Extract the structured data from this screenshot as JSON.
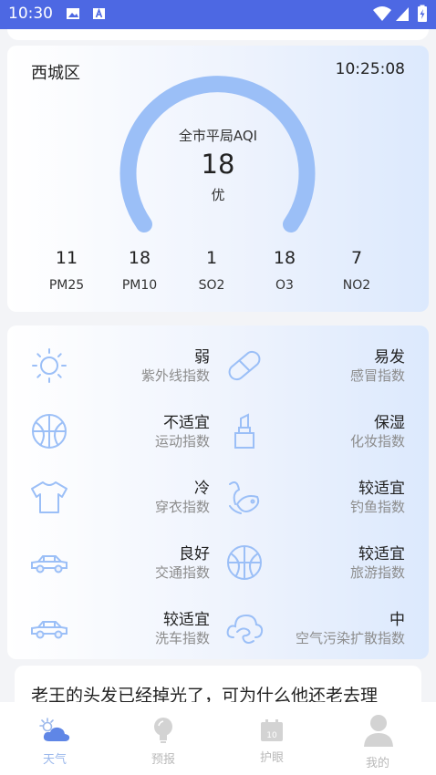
{
  "status_bar": {
    "time": "10:30",
    "icons": [
      "image-icon",
      "keyboard-a-icon",
      "wifi-icon",
      "signal-icon",
      "battery-charging-icon"
    ]
  },
  "aqi_card": {
    "district": "西城区",
    "clock": "10:25:08",
    "title": "全市平局AQI",
    "value": "18",
    "level": "优",
    "gauge_color": "#9bbff7",
    "pollutants": [
      {
        "value": "11",
        "name": "PM25"
      },
      {
        "value": "18",
        "name": "PM10"
      },
      {
        "value": "1",
        "name": "SO2"
      },
      {
        "value": "18",
        "name": "O3"
      },
      {
        "value": "7",
        "name": "NO2"
      }
    ]
  },
  "indices": [
    {
      "value": "弱",
      "name": "紫外线指数",
      "icon": "sun-icon"
    },
    {
      "value": "易发",
      "name": "感冒指数",
      "icon": "pill-icon"
    },
    {
      "value": "不适宜",
      "name": "运动指数",
      "icon": "basketball-icon"
    },
    {
      "value": "保湿",
      "name": "化妆指数",
      "icon": "lipstick-icon"
    },
    {
      "value": "冷",
      "name": "穿衣指数",
      "icon": "tshirt-icon"
    },
    {
      "value": "较适宜",
      "name": "钓鱼指数",
      "icon": "fish-icon"
    },
    {
      "value": "良好",
      "name": "交通指数",
      "icon": "car-icon"
    },
    {
      "value": "较适宜",
      "name": "旅游指数",
      "icon": "ball-icon"
    },
    {
      "value": "较适宜",
      "name": "洗车指数",
      "icon": "car-icon"
    },
    {
      "value": "中",
      "name": "空气污染扩散指数",
      "icon": "wind-cloud-icon"
    }
  ],
  "joke": {
    "text": "老王的头发已经掉光了，可为什么他还老去理"
  },
  "tabs": [
    {
      "label": "天气",
      "icon": "weather-icon",
      "active": true
    },
    {
      "label": "预报",
      "icon": "bulb-icon",
      "active": false
    },
    {
      "label": "护眼",
      "icon": "calendar-icon",
      "active": false
    },
    {
      "label": "我的",
      "icon": "user-icon",
      "active": false
    }
  ],
  "colors": {
    "status_bar": "#4d68e3",
    "icon_blue": "#9bbff7",
    "tab_active": "#9bb8ec",
    "tab_inactive": "#c8c8c8"
  }
}
